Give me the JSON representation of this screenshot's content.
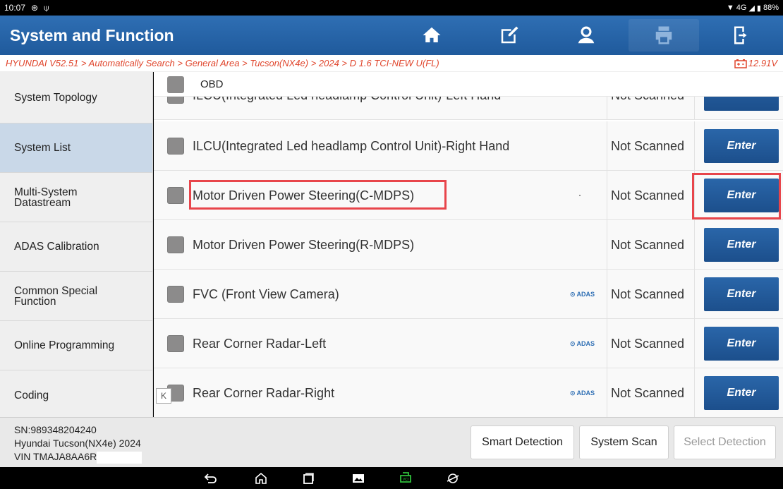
{
  "status_bar": {
    "time": "10:07",
    "network": "4G",
    "battery": "88%"
  },
  "header": {
    "title": "System and Function"
  },
  "breadcrumb": {
    "path": "HYUNDAI V52.51 > Automatically Search > General Area > Tucson(NX4e) > 2024 > D 1.6 TCI-NEW U(FL)",
    "voltage": "12.91V"
  },
  "sidebar": {
    "items": [
      {
        "label": "System Topology"
      },
      {
        "label": "System List"
      },
      {
        "label": "Multi-System Datastream"
      },
      {
        "label": "ADAS Calibration"
      },
      {
        "label": "Common Special Function"
      },
      {
        "label": "Online Programming"
      },
      {
        "label": "Coding"
      }
    ]
  },
  "list": {
    "pinned": {
      "label": "OBD"
    },
    "partial_row": {
      "name": "ILCU(Integrated Led headlamp Control Unit)-Left Hand",
      "status": "Not Scanned",
      "enter": "Enter"
    },
    "rows": [
      {
        "name": "ILCU(Integrated Led headlamp Control Unit)-Right Hand",
        "status": "Not Scanned",
        "enter": "Enter",
        "adas": ""
      },
      {
        "name": "Motor Driven Power Steering(C-MDPS)",
        "status": "Not Scanned",
        "enter": "Enter",
        "adas": ""
      },
      {
        "name": "Motor Driven Power Steering(R-MDPS)",
        "status": "Not Scanned",
        "enter": "Enter",
        "adas": ""
      },
      {
        "name": "FVC (Front View Camera)",
        "status": "Not Scanned",
        "enter": "Enter",
        "adas": "ADAS"
      },
      {
        "name": "Rear Corner Radar-Left",
        "status": "Not Scanned",
        "enter": "Enter",
        "adas": "ADAS"
      },
      {
        "name": "Rear Corner Radar-Right",
        "status": "Not Scanned",
        "enter": "Enter",
        "adas": "ADAS"
      }
    ],
    "collapse_glyph": "K"
  },
  "footer": {
    "sn": "SN:989348204240",
    "vehicle": "Hyundai Tucson(NX4e) 2024",
    "vin": "VIN TMAJA8AA6R",
    "smart_detection": "Smart Detection",
    "system_scan": "System Scan",
    "select_detection": "Select Detection"
  },
  "colors": {
    "accent": "#2f6fb4",
    "enter_button": "#1f5a9c",
    "highlight": "#e8454b",
    "breadcrumb": "#e0452c"
  }
}
